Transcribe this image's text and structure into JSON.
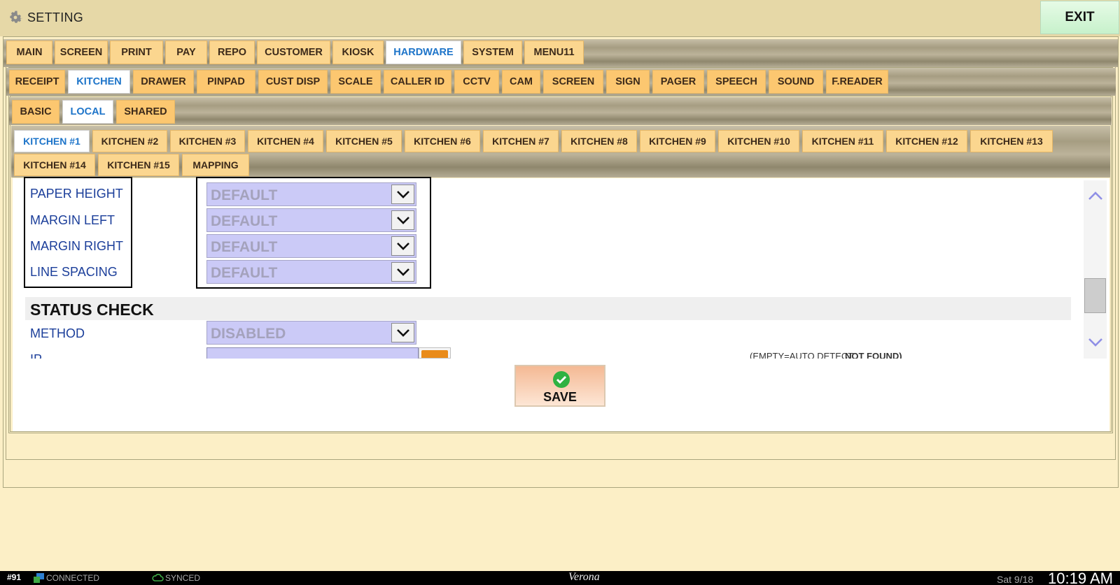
{
  "app": {
    "title": "SETTING",
    "exit_label": "EXIT"
  },
  "main_tabs": [
    "MAIN",
    "SCREEN",
    "PRINT",
    "PAY",
    "REPO",
    "CUSTOMER",
    "KIOSK",
    "HARDWARE",
    "SYSTEM",
    "MENU11"
  ],
  "main_active": "HARDWARE",
  "hardware_tabs": [
    "RECEIPT",
    "KITCHEN",
    "DRAWER",
    "PINPAD",
    "CUST DISP",
    "SCALE",
    "CALLER ID",
    "CCTV",
    "CAM",
    "SCREEN",
    "SIGN",
    "PAGER",
    "SPEECH",
    "SOUND",
    "F.READER"
  ],
  "hardware_active": "KITCHEN",
  "kitchen_tabs": [
    "BASIC",
    "LOCAL",
    "SHARED"
  ],
  "kitchen_active": "LOCAL",
  "printer_tabs": [
    "KITCHEN #1",
    "KITCHEN #2",
    "KITCHEN #3",
    "KITCHEN #4",
    "KITCHEN #5",
    "KITCHEN #6",
    "KITCHEN #7",
    "KITCHEN #8",
    "KITCHEN #9",
    "KITCHEN #10",
    "KITCHEN #11",
    "KITCHEN #12",
    "KITCHEN #13",
    "KITCHEN #14",
    "KITCHEN #15",
    "MAPPING"
  ],
  "printer_active": "KITCHEN #1",
  "settings": {
    "paper_height": {
      "label": "PAPER HEIGHT",
      "value": "DEFAULT"
    },
    "margin_left": {
      "label": "MARGIN LEFT",
      "value": "DEFAULT"
    },
    "margin_right": {
      "label": "MARGIN RIGHT",
      "value": "DEFAULT"
    },
    "line_spacing": {
      "label": "LINE SPACING",
      "value": "DEFAULT"
    }
  },
  "status_check": {
    "title": "STATUS CHECK",
    "method": {
      "label": "METHOD",
      "value": "DISABLED"
    },
    "ip": {
      "label": "IP",
      "value": "",
      "hint": "(EMPTY=AUTO DETECT",
      "hint_status": "NOT FOUND)"
    }
  },
  "save_label": "SAVE",
  "statusbar": {
    "station": "#91",
    "connection": "CONNECTED",
    "sync": "SYNCED",
    "venue": "Verona",
    "date": "Sat 9/18",
    "time": "10:19 AM"
  },
  "colors": {
    "tab": "#fbd68f",
    "tab_active_text": "#1d74c9",
    "label_text": "#1b3e9a",
    "select_bg": "#cbcaf7",
    "exit_bg": "#d5f5d8",
    "save_bg": "#f4b994",
    "page_bg": "#fcefc6"
  },
  "icons": [
    "settings-gear-icon",
    "chevron-down-icon",
    "keyboard-icon",
    "checkmark-icon",
    "scroll-up-icon",
    "scroll-down-icon",
    "network-icon",
    "cloud-icon"
  ]
}
